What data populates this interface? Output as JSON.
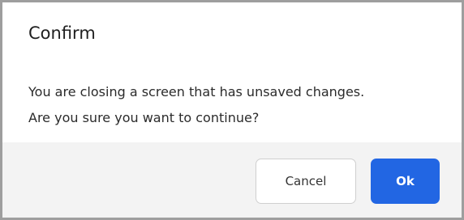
{
  "dialog": {
    "title": "Confirm",
    "message_line1": "You are closing a screen that has unsaved changes.",
    "message_line2": "Are you sure you want to continue?",
    "cancel_label": "Cancel",
    "ok_label": "Ok"
  },
  "colors": {
    "primary_button": "#2266e3",
    "footer_background": "#f3f3f3",
    "border": "#9e9e9e"
  }
}
